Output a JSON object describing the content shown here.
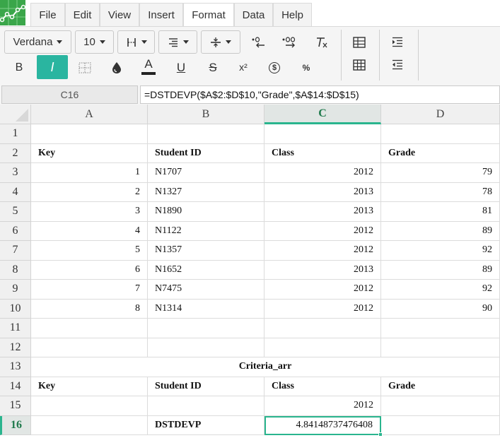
{
  "menu": [
    "File",
    "Edit",
    "View",
    "Insert",
    "Format",
    "Data",
    "Help"
  ],
  "menu_active": "Format",
  "toolbar": {
    "font_family": "Verdana",
    "font_size": "10",
    "bold_label": "B",
    "italic_label": "I",
    "text_color_label": "A",
    "underline_label": "U",
    "strike_label": "S",
    "superscript_label": "x²",
    "currency_label": "$",
    "percent_label": "%",
    "decimal_dec_label": ".0",
    "decimal_inc_label": ".00",
    "clear_format_label": "T"
  },
  "formula_bar": {
    "cell_ref": "C16",
    "formula": "=DSTDEVP($A$2:$D$10,\"Grade\",$A$14:$D$15)"
  },
  "columns": [
    "A",
    "B",
    "C",
    "D"
  ],
  "selected_column": "C",
  "selected_row": "16",
  "rows": [
    "1",
    "2",
    "3",
    "4",
    "5",
    "6",
    "7",
    "8",
    "9",
    "10",
    "11",
    "12",
    "13",
    "14",
    "15",
    "16"
  ],
  "cells": {
    "r2": [
      "Key",
      "Student ID",
      "Class",
      "Grade"
    ],
    "data": [
      [
        "1",
        "N1707",
        "2012",
        "79"
      ],
      [
        "2",
        "N1327",
        "2013",
        "78"
      ],
      [
        "3",
        "N1890",
        "2013",
        "81"
      ],
      [
        "4",
        "N1122",
        "2012",
        "89"
      ],
      [
        "5",
        "N1357",
        "2012",
        "92"
      ],
      [
        "6",
        "N1652",
        "2013",
        "89"
      ],
      [
        "7",
        "N7475",
        "2012",
        "92"
      ],
      [
        "8",
        "N1314",
        "2012",
        "90"
      ]
    ],
    "r13_title": "Criteria_arr",
    "r14": [
      "Key",
      "Student ID",
      "Class",
      "Grade"
    ],
    "r15_class": "2012",
    "r16_label": "DSTDEVP",
    "r16_result": "4.84148737476408"
  }
}
